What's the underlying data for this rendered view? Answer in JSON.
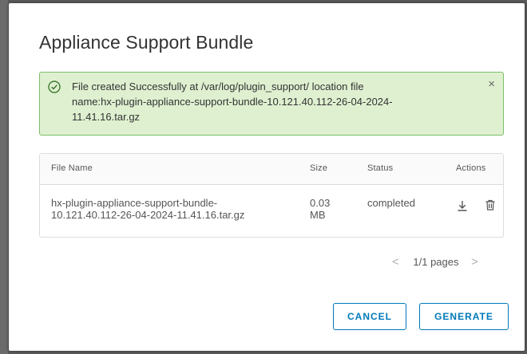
{
  "modal": {
    "title": "Appliance Support Bundle"
  },
  "alert": {
    "icon": "success-check-circle-icon",
    "line1": "File created Successfully at /var/log/plugin_support/ location file",
    "line2": "name:hx-plugin-appliance-support-bundle-10.121.40.112-26-04-2024-",
    "line3": "11.41.16.tar.gz",
    "close": "×",
    "colors": {
      "background": "#dff0d0",
      "border": "#7cbf6a"
    }
  },
  "table": {
    "columns": [
      "File Name",
      "Size",
      "Status",
      "Actions"
    ],
    "rows": [
      {
        "file_line1": "hx-plugin-appliance-support-bundle-",
        "file_line2": "10.121.40.112-26-04-2024-11.41.16.tar.gz",
        "size_line1": "0.03",
        "size_line2": "MB",
        "status": "completed",
        "actions": [
          "download-icon",
          "trash-icon"
        ]
      }
    ]
  },
  "pagination": {
    "prev": "<",
    "label": "1/1 pages",
    "next": ">"
  },
  "buttons": {
    "cancel": "CANCEL",
    "generate": "GENERATE"
  },
  "colors": {
    "accent": "#0079b8"
  }
}
